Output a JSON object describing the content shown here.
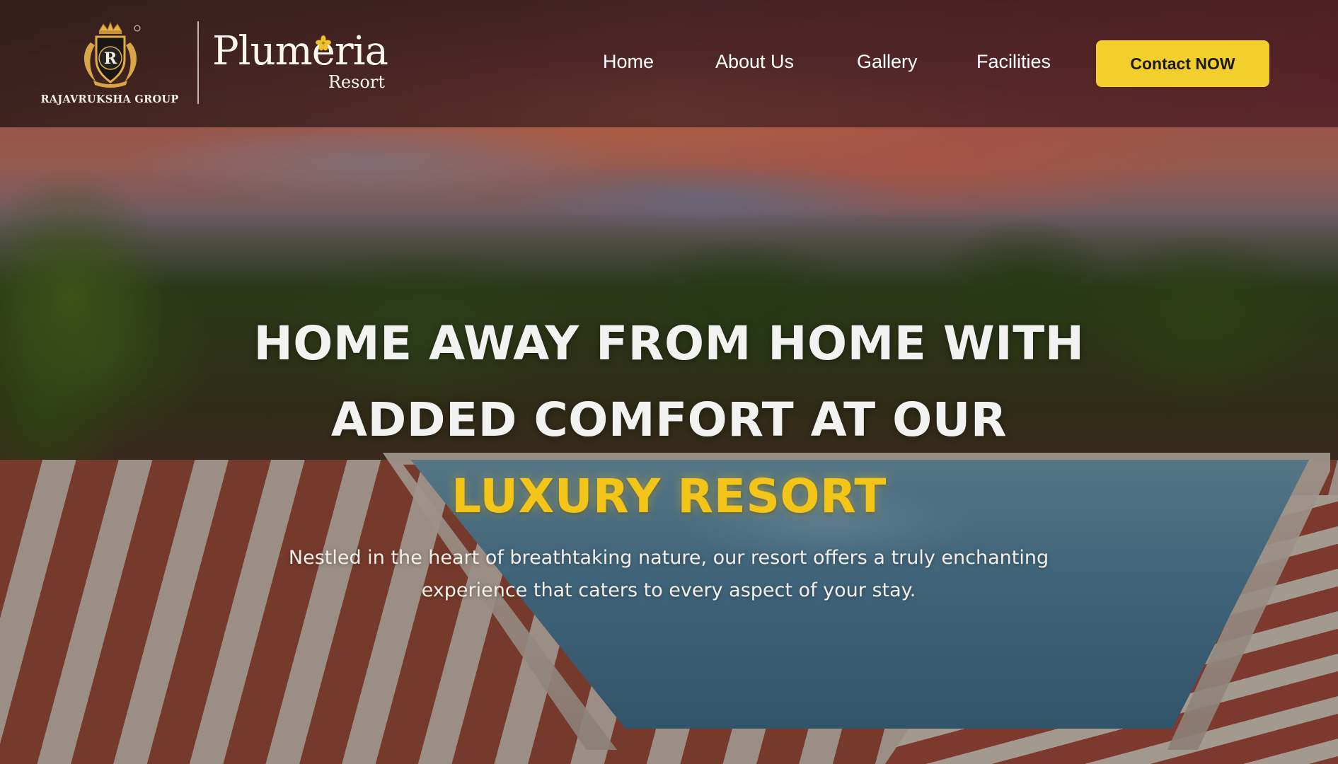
{
  "header": {
    "group_name": "RAJAVRUKSHA GROUP",
    "crest_letter": "R",
    "resort_name": "Plumeria",
    "resort_subtitle": "Resort"
  },
  "nav": {
    "items": [
      {
        "label": "Home"
      },
      {
        "label": "About Us"
      },
      {
        "label": "Gallery"
      },
      {
        "label": "Facilities"
      }
    ],
    "contact_label": "Contact NOW"
  },
  "hero": {
    "title_line1": "HOME AWAY FROM HOME WITH",
    "title_line2": "ADDED COMFORT AT OUR",
    "title_accent": "LUXURY RESORT",
    "subtitle": "Nestled in the heart of breathtaking nature, our resort offers a truly enchanting experience that caters to every aspect of your stay."
  },
  "colors": {
    "accent_yellow": "#f3cf2d",
    "title_accent": "#f3c518",
    "header_bg": "#3f2424",
    "text_white": "#ffffff"
  },
  "icons": {
    "crest": "royal-crest-icon",
    "flower": "plumeria-flower-icon"
  }
}
